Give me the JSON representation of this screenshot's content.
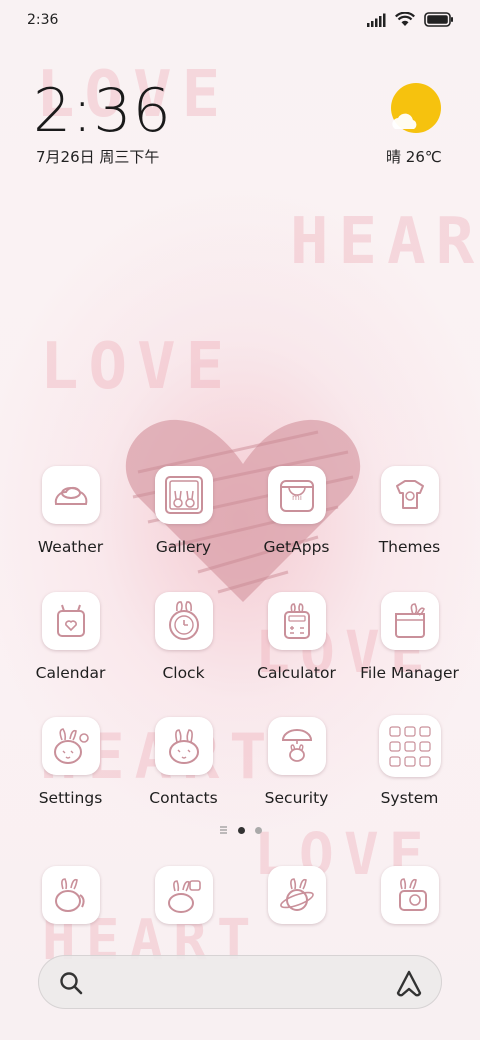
{
  "status_bar": {
    "time": "2:36",
    "signal_icon": "signal-icon",
    "wifi_icon": "wifi-icon",
    "battery_icon": "battery-icon"
  },
  "clock_widget": {
    "time": "2:36",
    "date": "7月26日 周三下午"
  },
  "weather_widget": {
    "condition": "晴",
    "temperature": "26℃",
    "icon": "sun-cloud-icon"
  },
  "wallpaper": {
    "words": [
      "LOVE",
      "HEAR",
      "LOVE",
      "LOVE",
      "HEART",
      "LOVE",
      "HEART"
    ]
  },
  "apps": [
    {
      "label": "Weather",
      "icon": "weather-icon"
    },
    {
      "label": "Gallery",
      "icon": "gallery-icon"
    },
    {
      "label": "GetApps",
      "icon": "getapps-icon"
    },
    {
      "label": "Themes",
      "icon": "themes-icon"
    },
    {
      "label": "Calendar",
      "icon": "calendar-icon"
    },
    {
      "label": "Clock",
      "icon": "clock-icon"
    },
    {
      "label": "Calculator",
      "icon": "calculator-icon"
    },
    {
      "label": "File Manager",
      "icon": "file-manager-icon"
    },
    {
      "label": "Settings",
      "icon": "settings-icon"
    },
    {
      "label": "Contacts",
      "icon": "contacts-icon"
    },
    {
      "label": "Security",
      "icon": "security-icon"
    },
    {
      "label": "System",
      "icon": "system-folder-icon"
    }
  ],
  "page_indicator": {
    "current_page": 1,
    "page_count": 2
  },
  "dock": [
    {
      "icon": "phone-icon"
    },
    {
      "icon": "messages-icon"
    },
    {
      "icon": "browser-icon"
    },
    {
      "icon": "camera-icon"
    }
  ],
  "search_bar": {
    "search_icon": "search-icon",
    "assistant_icon": "assistant-icon"
  },
  "colors": {
    "icon_line": "#c9909a",
    "heart": "#d9a0aa",
    "accent_sun": "#f6c20e"
  }
}
